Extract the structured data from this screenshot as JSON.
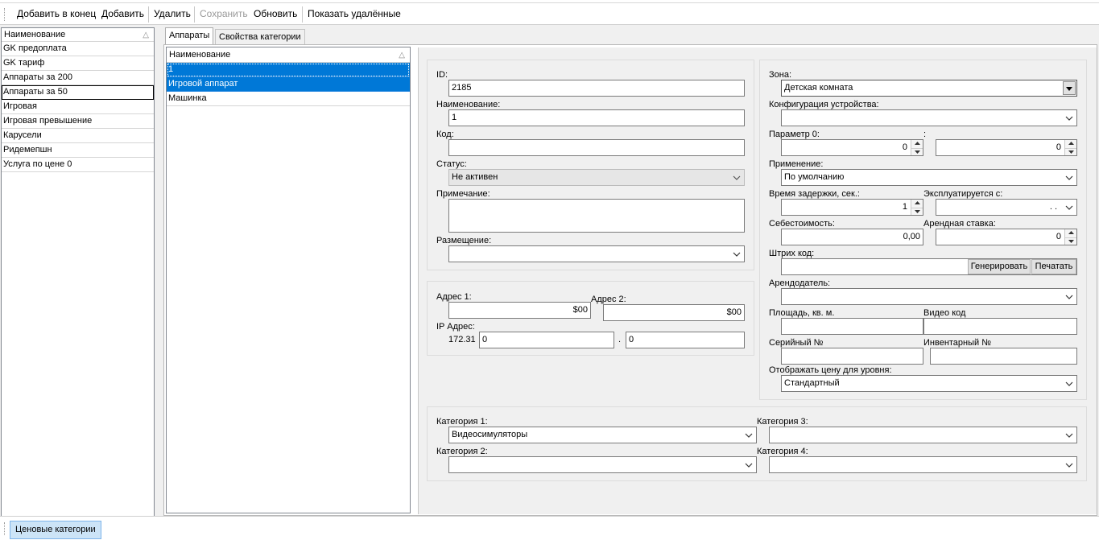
{
  "toolbar": {
    "add_to_end": "Добавить в конец",
    "add": "Добавить",
    "delete": "Удалить",
    "save": "Сохранить",
    "refresh": "Обновить",
    "show_deleted": "Показать удалённые"
  },
  "categories": {
    "header": "Наименование",
    "items": [
      "GK  предоплата",
      "GK тариф",
      "Аппараты за 200",
      "Аппараты за 50",
      "Игровая",
      "Игровая превышение",
      "Карусели",
      "Ридемепшн",
      "Услуга по цене 0"
    ],
    "selected_index": 3
  },
  "tabs": [
    "Аппараты",
    "Свойства категории"
  ],
  "devices": {
    "header": "Наименование",
    "items": [
      "1",
      "Игровой аппарат",
      "Машинка"
    ]
  },
  "form": {
    "id_label": "ID:",
    "id_value": "2185",
    "name_label": "Наименование:",
    "name_value": "1",
    "code_label": "Код:",
    "code_value": "",
    "status_label": "Статус:",
    "status_value": "Не активен",
    "note_label": "Примечание:",
    "note_value": "",
    "placement_label": "Размещение:",
    "placement_value": "",
    "addr1_label": "Адрес 1:",
    "addr1_value": "$00",
    "addr2_label": "Адрес 2:",
    "addr2_value": "$00",
    "ip_label": "IP Адрес:",
    "ip_prefix": "172.31",
    "ip_part1": "0",
    "ip_dot": ".",
    "ip_part2": "0",
    "zone_label": "Зона:",
    "zone_value": "Детская комната",
    "config_label": "Конфигурация устройства:",
    "config_value": "",
    "param0_label": "Параметр 0:",
    "param0_value": "0",
    "param_colon": ":",
    "param1_value": "0",
    "usage_label": "Применение:",
    "usage_value": "По умолчанию",
    "delay_label": "Время задержки, сек.:",
    "delay_value": "1",
    "exploited_label": "Эксплуатируется с:",
    "exploited_value": ". .",
    "cost_label": "Себестоимость:",
    "cost_value": "0,00",
    "rent_label": "Арендная ставка:",
    "rent_value": "0",
    "barcode_label": "Штрих код:",
    "barcode_value": "",
    "generate_btn": "Генерировать",
    "print_btn": "Печатать",
    "landlord_label": "Арендодатель:",
    "landlord_value": "",
    "area_label": "Площадь, кв. м.",
    "area_value": "",
    "video_label": "Видео код",
    "video_value": "",
    "serial_label": "Серийный №",
    "serial_value": "",
    "inventory_label": "Инвентарный №",
    "inventory_value": "",
    "price_level_label": "Отображать цену для уровня:",
    "price_level_value": "Стандартный",
    "cat1_label": "Категория 1:",
    "cat1_value": "Видеосимуляторы",
    "cat2_label": "Категория 2:",
    "cat2_value": "",
    "cat3_label": "Категория 3:",
    "cat3_value": "",
    "cat4_label": "Категория 4:",
    "cat4_value": ""
  },
  "status_bar": {
    "price_categories": "Ценовые категории"
  },
  "colors": {
    "selection": "#0078d7",
    "status_button": "#cce4f7"
  }
}
